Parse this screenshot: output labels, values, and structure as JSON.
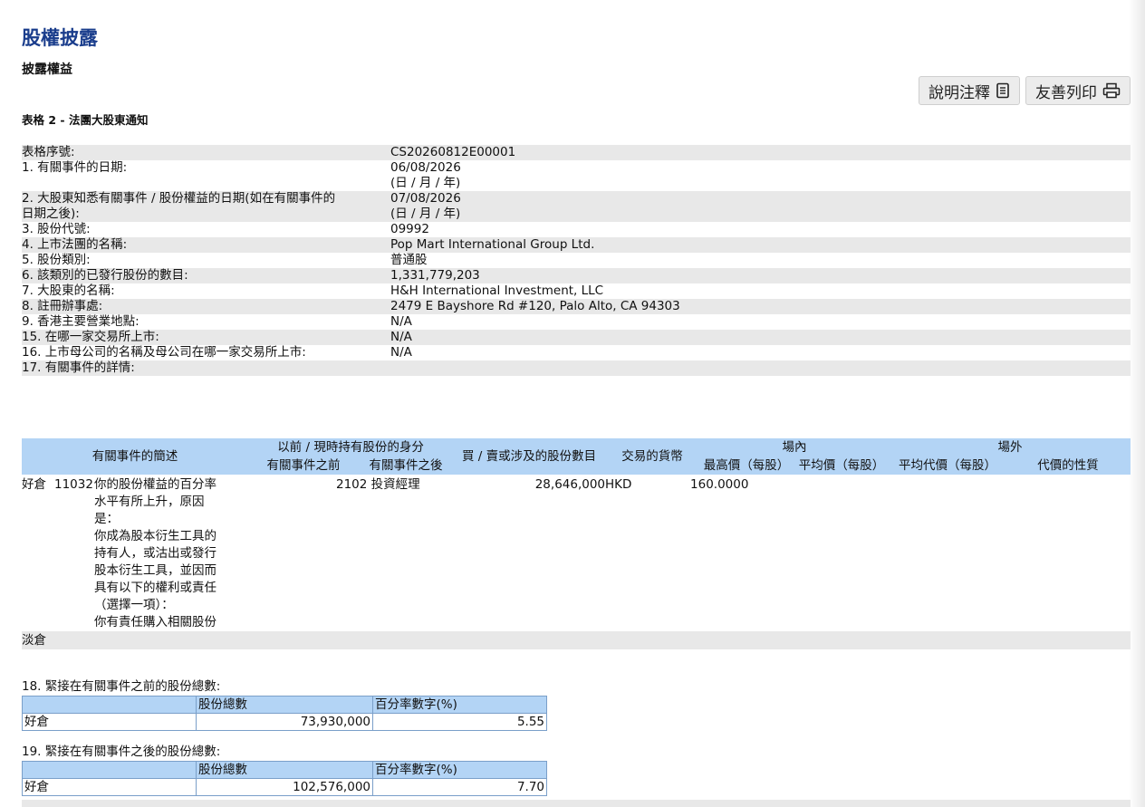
{
  "page": {
    "title": "股權披露",
    "subtitle": "披露權益",
    "form_heading": "表格 2 - 法團大股東通知"
  },
  "toolbar": {
    "notes_label": "說明注釋",
    "print_label": "友善列印"
  },
  "info_rows": [
    {
      "label": "表格序號:",
      "value": "CS20260812E00001"
    },
    {
      "label": "1. 有關事件的日期:",
      "value": "06/08/2026",
      "value2": "(日 / 月 / 年)"
    },
    {
      "label": "2. 大股東知悉有關事件 / 股份權益的日期(如在有關事件的",
      "label2": "日期之後):",
      "value": "07/08/2026",
      "value2": "(日 / 月 / 年)"
    },
    {
      "label": "3. 股份代號:",
      "value": "09992"
    },
    {
      "label": "4. 上市法團的名稱:",
      "value": "Pop Mart International Group Ltd."
    },
    {
      "label": "5. 股份類別:",
      "value": "普通股"
    },
    {
      "label": "6. 該類別的已發行股份的數目:",
      "value": "1,331,779,203"
    },
    {
      "label": "7. 大股東的名稱:",
      "value": "H&H International Investment, LLC"
    },
    {
      "label": "8. 註冊辦事處:",
      "value": "2479 E Bayshore Rd #120, Palo Alto, CA 94303"
    },
    {
      "label": "9. 香港主要營業地點:",
      "value": "N/A"
    },
    {
      "label": "15. 在哪一家交易所上市:",
      "value": "N/A"
    },
    {
      "label": "16. 上市母公司的名稱及母公司在哪一家交易所上市:",
      "value": "N/A"
    },
    {
      "label": "17. 有關事件的詳情:",
      "value": ""
    }
  ],
  "details": {
    "headers": {
      "event_summary": "有關事件的簡述",
      "capacity": "以前 / 現時持有股份的身分",
      "before": "有關事件之前",
      "after": "有關事件之後",
      "shares_involved": "買 / 賣或涉及的股份數目",
      "currency": "交易的貨幣",
      "on_exchange": "場內",
      "highest_price": "最高價（每股）",
      "average_price": "平均價（每股）",
      "off_exchange": "場外",
      "avg_consideration": "平均代價（每股）",
      "consideration_nature": "代價的性質"
    },
    "row": {
      "position": "好倉",
      "code": "11032",
      "description_lines": [
        "你的股份權益的百分率",
        "水平有所上升，原因",
        "是：",
        "你成為股本衍生工具的",
        "持有人，或沽出或發行",
        "股本衍生工具，並因而",
        "具有以下的權利或責任",
        "（選擇一項）：",
        "你有責任購入相關股份"
      ],
      "capacity_code": "2102",
      "capacity": "投資經理",
      "shares": "28,646,000",
      "currency": "HKD",
      "highest_price": "160.0000"
    },
    "short_position": "淡倉"
  },
  "before_block": {
    "label": "18. 緊接在有關事件之前的股份總數:",
    "col_total": "股份總數",
    "col_percent": "百分率數字(%)",
    "row_label": "好倉",
    "total": "73,930,000",
    "percent": "5.55"
  },
  "after_block": {
    "label": "19. 緊接在有關事件之後的股份總數:",
    "col_total": "股份總數",
    "col_percent": "百分率數字(%)",
    "row_label": "好倉",
    "total": "102,576,000",
    "percent": "7.70"
  }
}
